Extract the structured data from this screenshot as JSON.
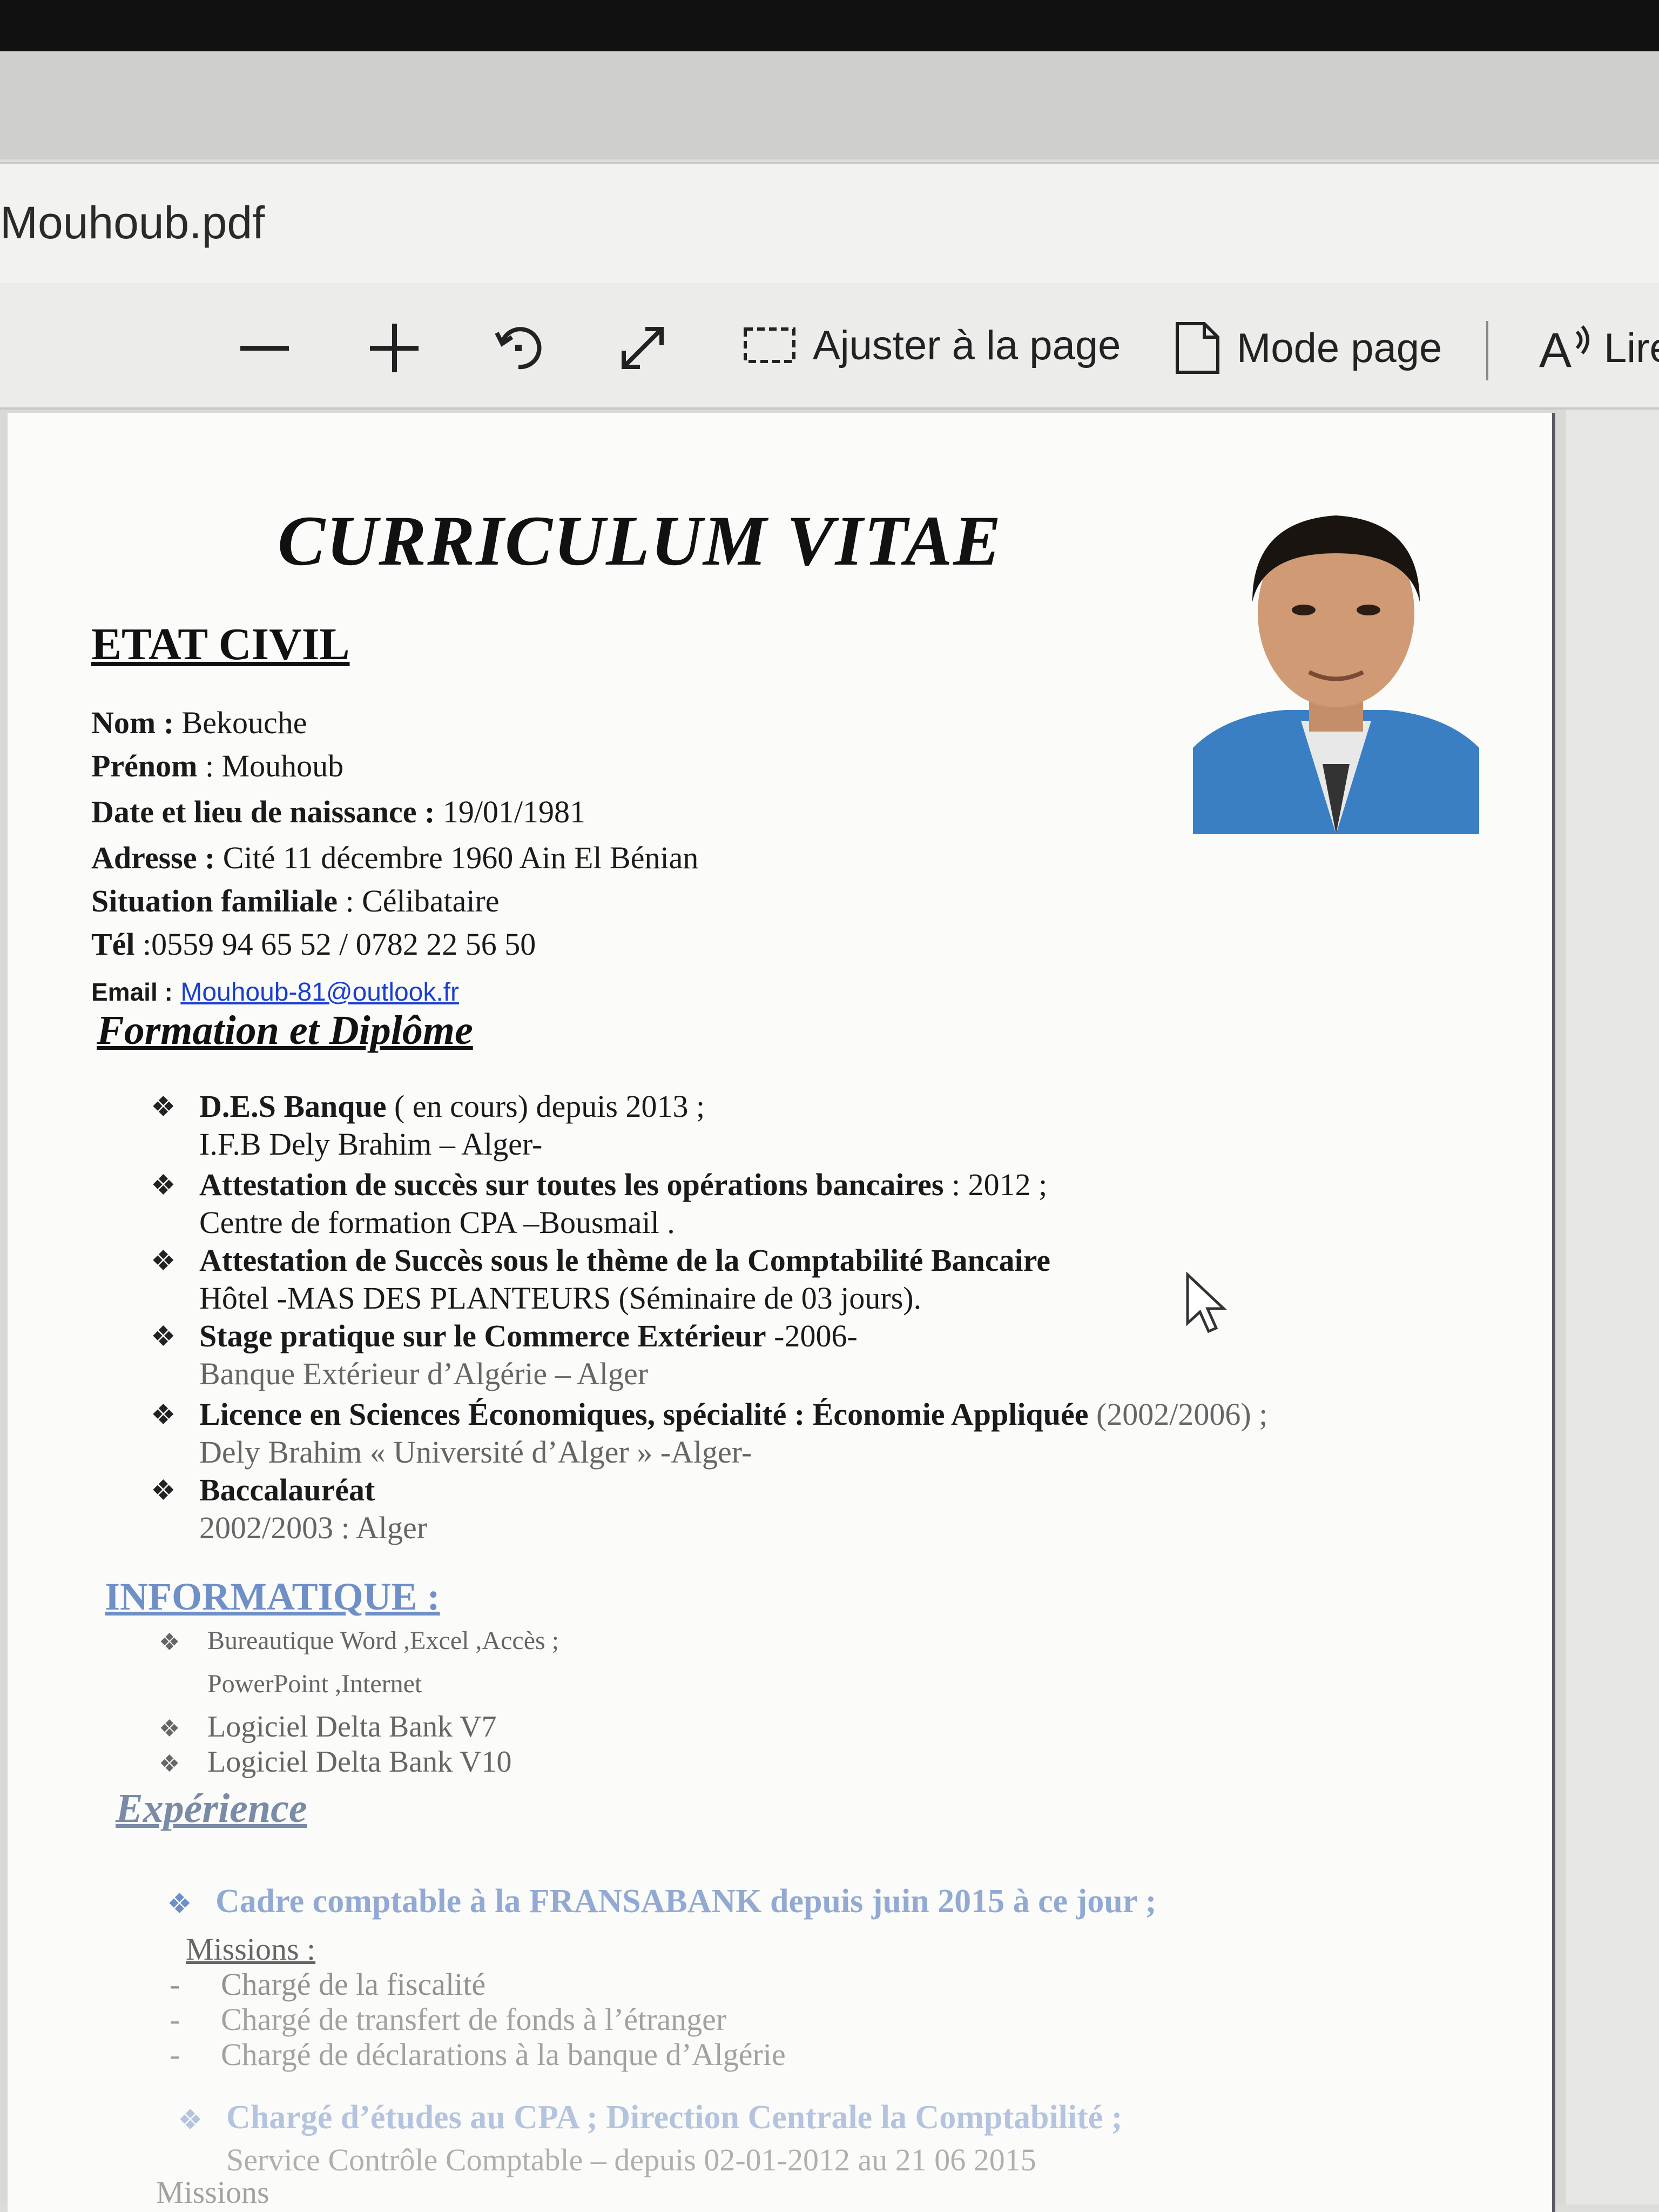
{
  "window": {
    "title": "Mouhoub.pdf"
  },
  "toolbar": {
    "zoom_out_icon": "minus-icon",
    "zoom_in_icon": "plus-icon",
    "rotate_icon": "rotate-icon",
    "fullscreen_icon": "expand-icon",
    "fit_label": "Ajuster à la page",
    "mode_label": "Mode page",
    "read_label": "Lire"
  },
  "cv": {
    "title": "CURRICULUM VITAE",
    "etat_civil": {
      "heading": "ETAT CIVIL",
      "nom_label": "Nom :",
      "nom_value": " Bekouche",
      "prenom_label": "Prénom",
      "prenom_value": " : Mouhoub",
      "naissance_label": "Date et lieu de naissance :",
      "naissance_value": " 19/01/1981",
      "adresse_label": "Adresse :",
      "adresse_value": "  Cité 11 décembre 1960 Ain El Bénian",
      "situation_label": "Situation familiale",
      "situation_value": " : Célibataire",
      "tel_label": "Tél",
      "tel_value": " :0559 94 65 52 / 0782 22 56 50",
      "email_label": "Email :",
      "email_value": "Mouhoub-81@outlook.fr"
    },
    "formation": {
      "heading": "Formation et Diplôme",
      "items": [
        {
          "bold": "D.E.S Banque",
          "rest": " ( en cours) depuis 2013 ;",
          "sub": "I.F.B Dely Brahim – Alger-"
        },
        {
          "bold": "Attestation  de succès sur toutes les opérations bancaires",
          "rest": " : 2012 ;",
          "sub": "Centre de formation CPA –Bousmail ."
        },
        {
          "bold": "Attestation de Succès sous le thème de la Comptabilité Bancaire",
          "rest": "",
          "sub": "Hôtel -MAS DES PLANTEURS (Séminaire de 03 jours)."
        },
        {
          "bold": "Stage pratique sur le Commerce Extérieur",
          "rest": " -2006-",
          "sub": " Banque Extérieur d’Algérie – Alger"
        },
        {
          "bold": "Licence en Sciences Économiques, spécialité : Économie Appliquée",
          "rest": "  (2002/2006) ;",
          "sub": "Dely Brahim  « Université d’Alger » -Alger-"
        },
        {
          "bold": "Baccalauréat",
          "rest": "",
          "sub": "2002/2003 :    Alger"
        }
      ]
    },
    "informatique": {
      "heading": "INFORMATIQUE :",
      "items": [
        "Bureautique   Word ,Excel ,Accès ;",
        "PowerPoint  ,Internet",
        "Logiciel Delta Bank V7",
        "Logiciel Delta Bank V10"
      ]
    },
    "experience": {
      "heading": "Expérience",
      "job1": "Cadre comptable à la FRANSABANK depuis juin 2015  à ce jour ;",
      "missions_label": "Missions :",
      "missions": [
        "Chargé de la fiscalité",
        "Chargé de transfert de fonds à l’étranger",
        "Chargé de déclarations à la banque  d’Algérie"
      ],
      "job2": "Chargé d’études au CPA ; Direction Centrale la Comptabilité ;",
      "job2_sub": "Service Contrôle Comptable – depuis  02-01-2012 au 21 06 2015",
      "missions_label2": "Missions"
    }
  }
}
